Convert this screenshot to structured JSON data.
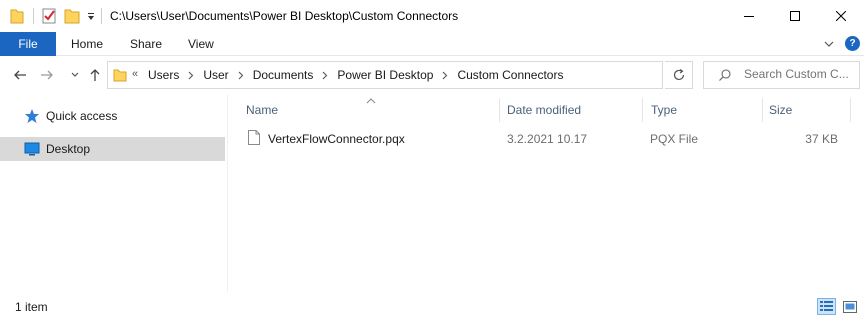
{
  "window": {
    "title": "C:\\Users\\User\\Documents\\Power BI Desktop\\Custom Connectors"
  },
  "ribbon": {
    "tabs": [
      {
        "label": "File",
        "active": true
      },
      {
        "label": "Home"
      },
      {
        "label": "Share"
      },
      {
        "label": "View"
      }
    ],
    "help_label": "?"
  },
  "address": {
    "overflow_glyph": "«",
    "crumbs": [
      "Users",
      "User",
      "Documents",
      "Power BI Desktop",
      "Custom Connectors"
    ]
  },
  "search": {
    "placeholder": "Search Custom C..."
  },
  "nav_pane": {
    "items": [
      {
        "label": "Quick access",
        "icon": "star-icon"
      },
      {
        "label": "Desktop",
        "icon": "desktop-icon",
        "selected": true
      }
    ]
  },
  "file_list": {
    "columns": [
      "Name",
      "Date modified",
      "Type",
      "Size"
    ],
    "sorted_by": "Name",
    "rows": [
      {
        "name": "VertexFlowConnector.pqx",
        "date_modified": "3.2.2021 10.17",
        "type": "PQX File",
        "size": "37 KB"
      }
    ]
  },
  "status": {
    "item_count": "1 item",
    "view_mode": "details"
  },
  "colors": {
    "accent": "#1a66c0",
    "selection": "#d9d9d9",
    "header_text": "#4c607a"
  }
}
